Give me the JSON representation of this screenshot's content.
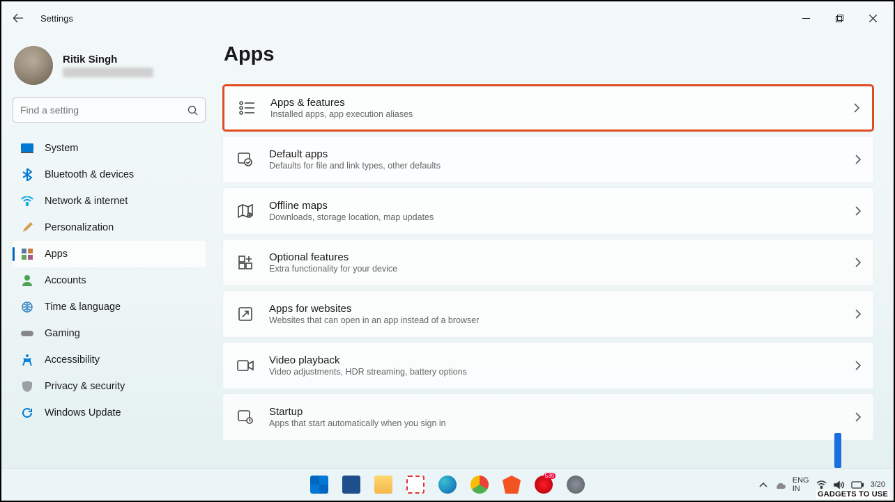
{
  "window": {
    "title": "Settings"
  },
  "user": {
    "name": "Ritik Singh"
  },
  "search": {
    "placeholder": "Find a setting"
  },
  "nav": [
    {
      "label": "System"
    },
    {
      "label": "Bluetooth & devices"
    },
    {
      "label": "Network & internet"
    },
    {
      "label": "Personalization"
    },
    {
      "label": "Apps"
    },
    {
      "label": "Accounts"
    },
    {
      "label": "Time & language"
    },
    {
      "label": "Gaming"
    },
    {
      "label": "Accessibility"
    },
    {
      "label": "Privacy & security"
    },
    {
      "label": "Windows Update"
    }
  ],
  "page": {
    "title": "Apps"
  },
  "cards": [
    {
      "title": "Apps & features",
      "sub": "Installed apps, app execution aliases"
    },
    {
      "title": "Default apps",
      "sub": "Defaults for file and link types, other defaults"
    },
    {
      "title": "Offline maps",
      "sub": "Downloads, storage location, map updates"
    },
    {
      "title": "Optional features",
      "sub": "Extra functionality for your device"
    },
    {
      "title": "Apps for websites",
      "sub": "Websites that can open in an app instead of a browser"
    },
    {
      "title": "Video playback",
      "sub": "Video adjustments, HDR streaming, battery options"
    },
    {
      "title": "Startup",
      "sub": "Apps that start automatically when you sign in"
    }
  ],
  "tray": {
    "lang1": "ENG",
    "lang2": "IN",
    "date": "3/20"
  },
  "watermark": "GADGETS TO USE"
}
